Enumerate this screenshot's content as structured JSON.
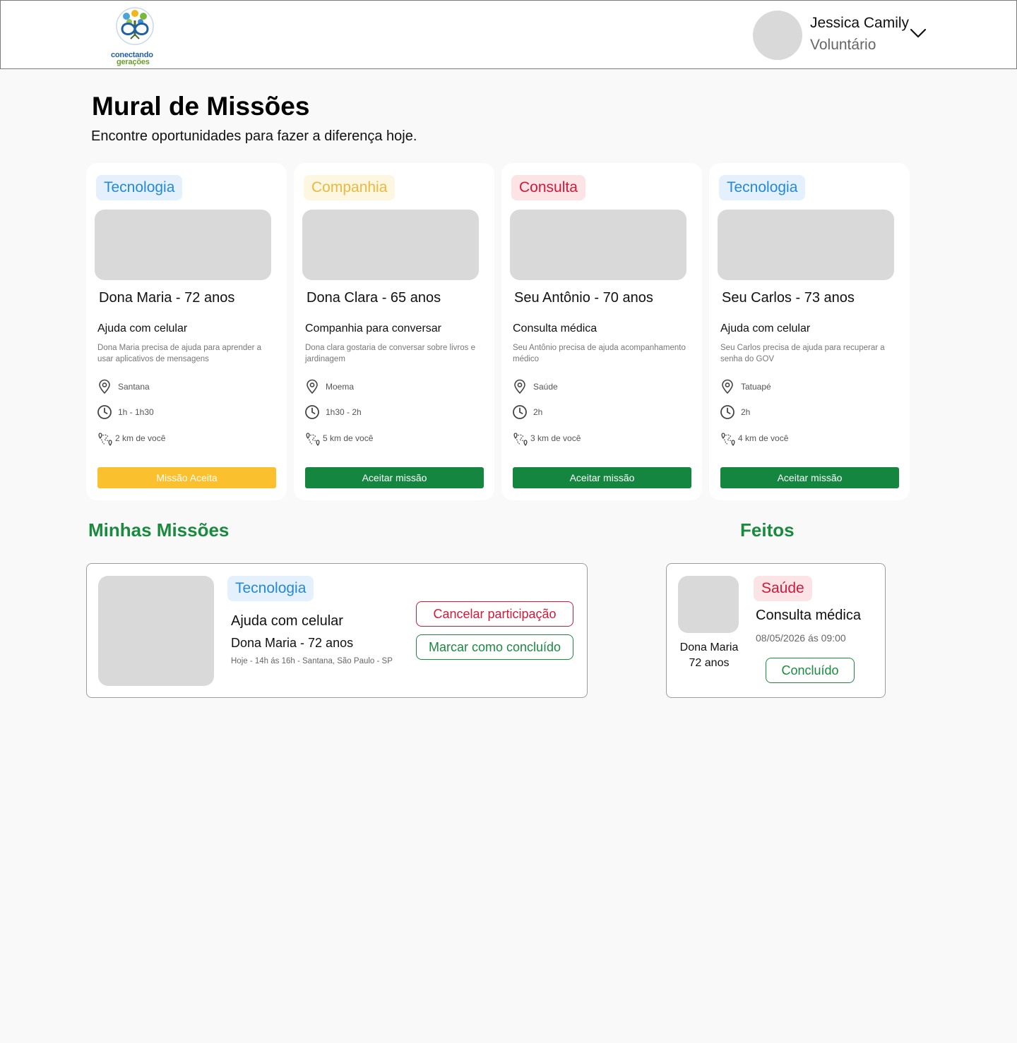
{
  "header": {
    "logo_line1": "conectando",
    "logo_line2": "gerações",
    "user_name": "Jessica Camily",
    "user_role": "Voluntário"
  },
  "page": {
    "title": "Mural de Missões",
    "subtitle": "Encontre oportunidades para fazer a diferença hoje."
  },
  "missions": [
    {
      "tag": "Tecnologia",
      "tag_color": "#2589d4",
      "name": "Dona Maria - 72 anos",
      "title": "Ajuda com celular",
      "description": "Dona Maria precisa de ajuda para aprender a usar aplicativos de mensagens",
      "location": "Santana",
      "duration": "1h - 1h30",
      "distance": "2 km de você",
      "button": "Missão Aceita"
    },
    {
      "tag": "Companhia",
      "tag_color": "#e9b940",
      "name": "Dona Clara - 65 anos",
      "title": "Companhia para conversar",
      "description": "Dona clara gostaria de conversar sobre livros e jardinagem",
      "location": "Moema",
      "duration": "1h30 - 2h",
      "distance": "5 km de você",
      "button": "Aceitar missão"
    },
    {
      "tag": "Consulta",
      "tag_color": "#d01a3a",
      "name": "Seu Antônio - 70 anos",
      "title": "Consulta médica",
      "description": "Seu Antônio precisa de ajuda acompanhamento médico",
      "location": "Saúde",
      "duration": "2h",
      "distance": "3 km de você",
      "button": "Aceitar missão"
    },
    {
      "tag": "Tecnologia",
      "tag_color": "#2589d4",
      "name": "Seu Carlos - 73 anos",
      "title": "Ajuda com celular",
      "description": "Seu Carlos precisa de ajuda para recuperar a senha do GOV",
      "location": "Tatuapé",
      "duration": "2h",
      "distance": "4 km de você",
      "button": "Aceitar missão"
    }
  ],
  "my_missions": {
    "section_title": "Minhas Missões",
    "tag": "Tecnologia",
    "title": "Ajuda com celular",
    "name": "Dona Maria - 72 anos",
    "meta": "Hoje - 14h ás 16h - Santana, São Paulo - SP",
    "cancel_button": "Cancelar participação",
    "complete_button": "Marcar como concluído"
  },
  "achievements": {
    "section_title": "Feitos",
    "person_name": "Dona Maria",
    "person_age": "72 anos",
    "tag": "Saúde",
    "title": "Consulta médica",
    "date": "08/05/2026 ás 09:00",
    "status_button": "Concluído"
  },
  "colors": {
    "brand_green": "#14863f",
    "accepted_yellow": "#fbc02d",
    "danger_red": "#d01a3a",
    "tech_blue": "#2589d4"
  }
}
